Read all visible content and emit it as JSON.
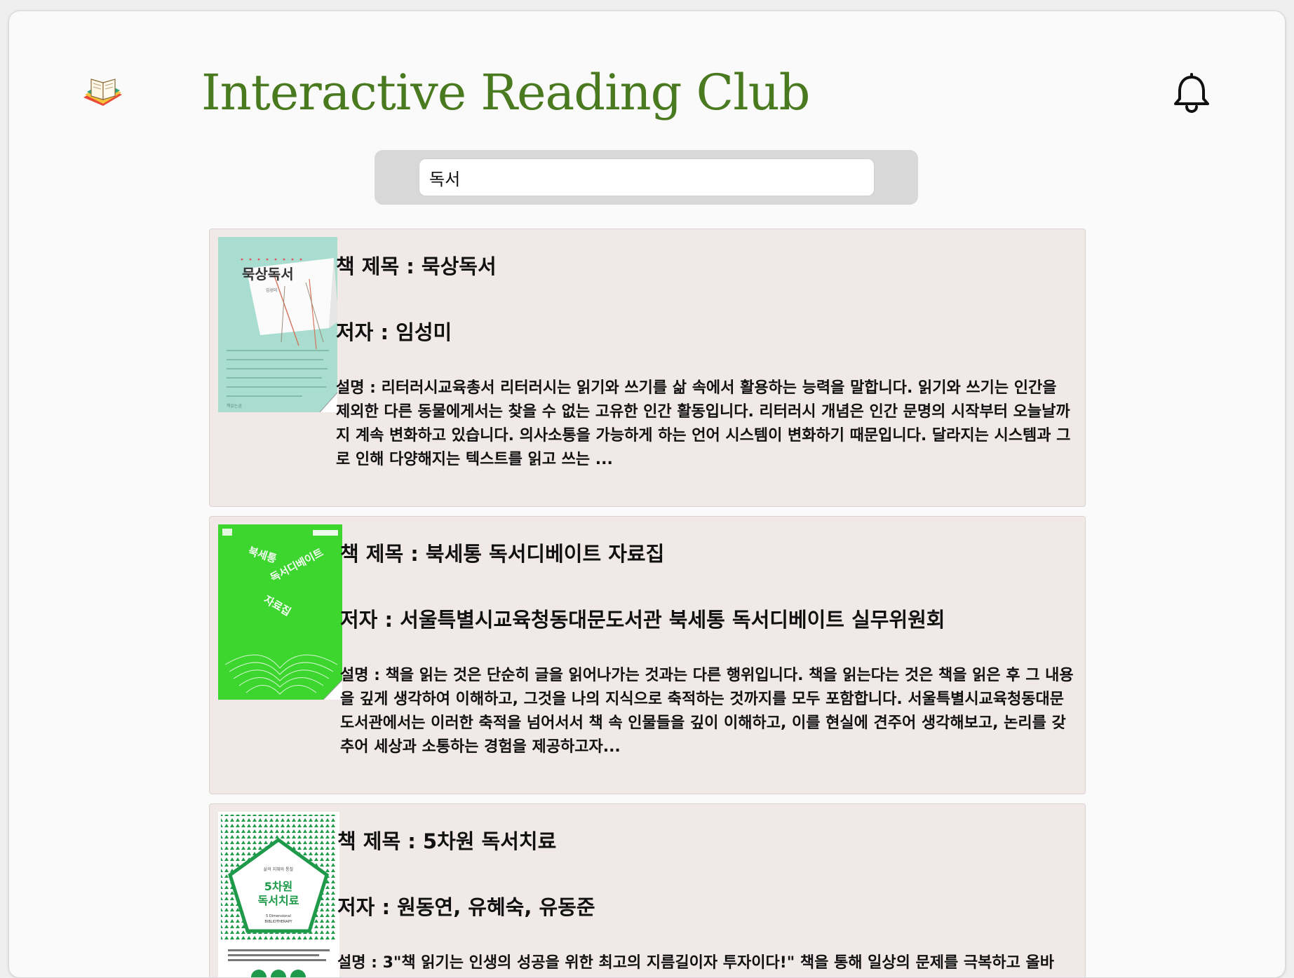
{
  "header": {
    "title": "Interactive Reading Club",
    "logo_icon": "open-book-icon",
    "notification_icon": "bell-icon"
  },
  "search": {
    "value": "독서",
    "placeholder": ""
  },
  "books": [
    {
      "title_label": "책 제목 : 묵상독서",
      "author_label": "저자 : 임성미",
      "description": "설명 : 리터러시교육총서 리터러시는 읽기와 쓰기를 삶 속에서 활용하는 능력을 말합니다. 읽기와 쓰기는 인간을 제외한 다른 동물에게서는 찾을 수 없는 고유한 인간 활동입니다. 리터러시 개념은 인간 문명의 시작부터 오늘날까지 계속 변화하고 있습니다. 의사소통을 가능하게 하는 언어 시스템이 변화하기 때문입니다. 달라지는 시스템과 그로 인해 다양해지는 텍스트를 읽고 쓰는 ...",
      "cover": {
        "title": "묵상독서",
        "author": "임성미",
        "color": "#a8ddcf"
      }
    },
    {
      "title_label": "책 제목 : 북세통 독서디베이트 자료집",
      "author_label": "저자 : 서울특별시교육청동대문도서관 북세통 독서디베이트 실무위원회",
      "description": "설명 : 책을 읽는 것은 단순히 글을 읽어나가는 것과는 다른 행위입니다. 책을 읽는다는 것은 책을 읽은 후 그 내용을 깊게 생각하여 이해하고, 그것을 나의 지식으로 축적하는 것까지를 모두 포함합니다. 서울특별시교육청동대문도서관에서는 이러한 축적을 넘어서서 책 속 인물들을 깊이 이해하고, 이를 현실에 견주어 생각해보고, 논리를 갖추어 세상과 소통하는 경험을 제공하고자...",
      "cover": {
        "line1": "북세통",
        "line2": "독서디베이트",
        "line3": "자료집",
        "color": "#3cd62e"
      }
    },
    {
      "title_label": "책 제목 : 5차원 독서치료",
      "author_label": "저자 : 원동연, 유혜숙, 유동준",
      "description": "설명 : 3\"책 읽기는 인생의 성공을 위한 최고의 지름길이자 투자이다!\" 책을 통해 일상의 문제를 극복하고 올바른...",
      "cover": {
        "line1": "5차원",
        "line2": "독서치료",
        "subtitle": "5 Dimensional BIBLIOTHERAPY",
        "color": "#1f9a4a"
      }
    }
  ],
  "colors": {
    "title_green": "#4a7a1f",
    "card_bg": "#f1e8e8",
    "search_bg": "#d8d8d8"
  }
}
